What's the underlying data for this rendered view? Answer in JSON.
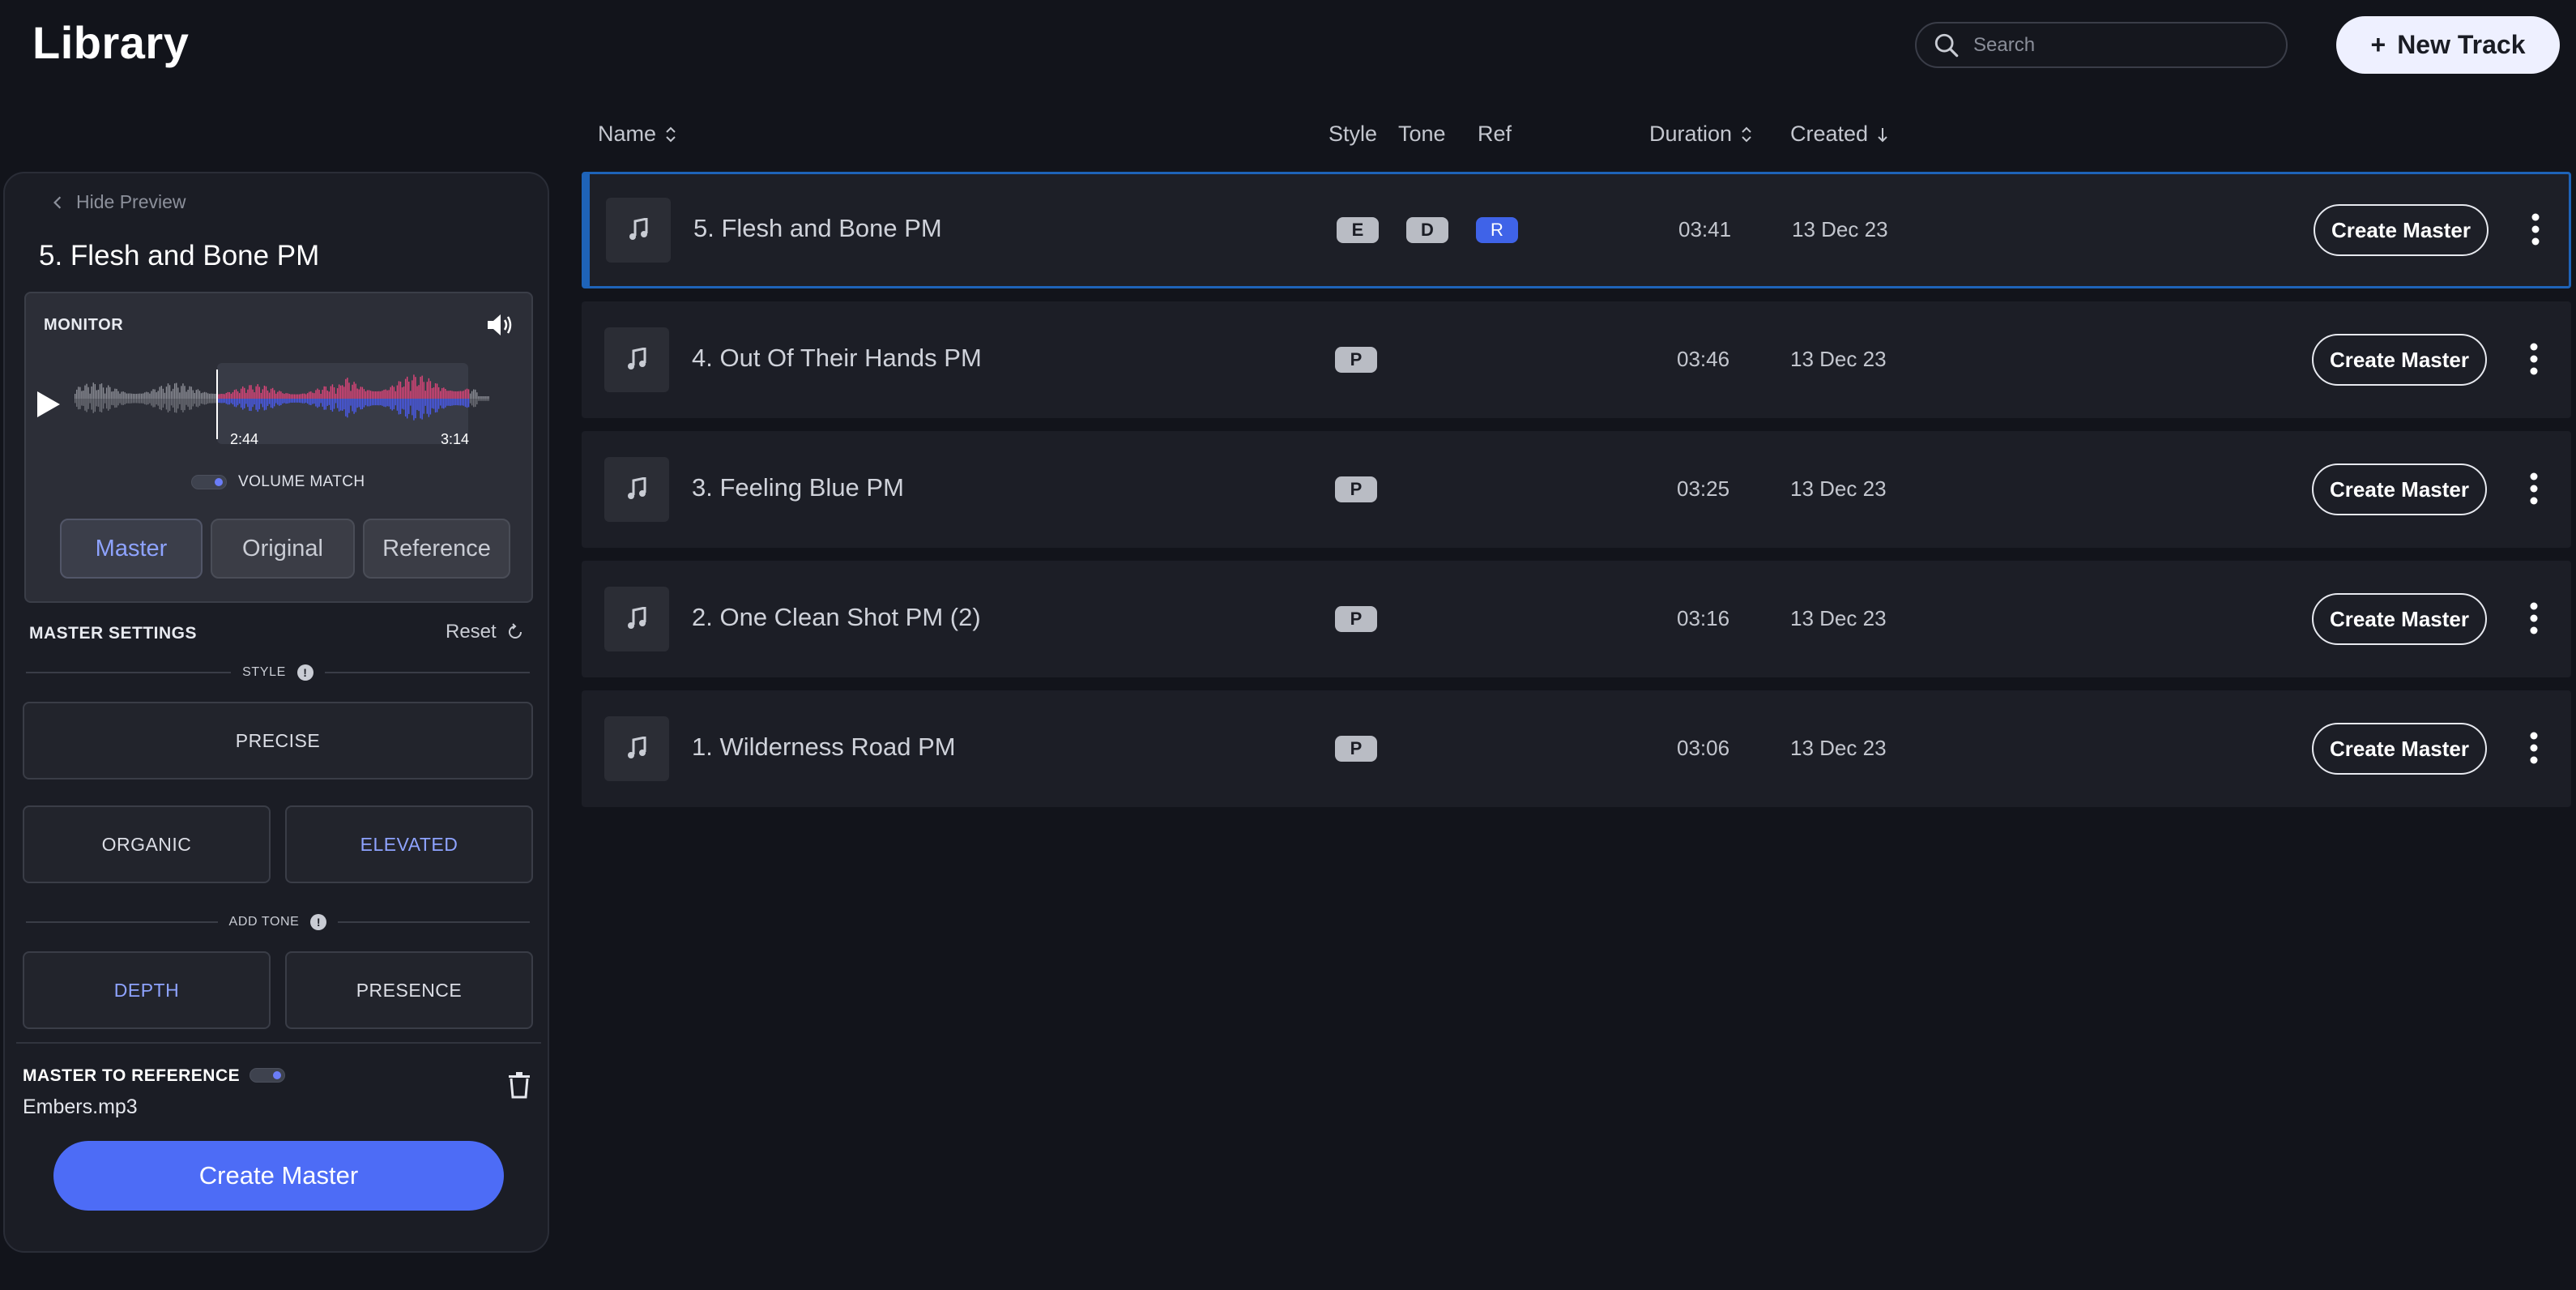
{
  "header": {
    "title": "Library",
    "search_placeholder": "Search",
    "new_track_label": "New Track"
  },
  "preview": {
    "hide_label": "Hide Preview",
    "track_title": "5. Flesh and Bone PM",
    "monitor": {
      "label": "MONITOR",
      "region_start": "2:44",
      "region_end": "3:14",
      "volume_match_label": "VOLUME MATCH",
      "modes": [
        "Master",
        "Original",
        "Reference"
      ],
      "active_mode": "Master"
    },
    "settings": {
      "title": "MASTER SETTINGS",
      "reset_label": "Reset",
      "style_label": "STYLE",
      "style_options": [
        "PRECISE",
        "ORGANIC",
        "ELEVATED"
      ],
      "active_style": "ELEVATED",
      "tone_label": "ADD TONE",
      "tone_options": [
        "DEPTH",
        "PRESENCE"
      ],
      "active_tone": "DEPTH"
    },
    "reference": {
      "title": "MASTER TO REFERENCE",
      "file": "Embers.mp3"
    },
    "create_label": "Create Master"
  },
  "table": {
    "columns": {
      "name": "Name",
      "style": "Style",
      "tone": "Tone",
      "ref": "Ref",
      "duration": "Duration",
      "created": "Created"
    },
    "row_button_label": "Create Master",
    "rows": [
      {
        "name": "5. Flesh and Bone PM",
        "style": "E",
        "tone": "D",
        "ref": "R",
        "duration": "03:41",
        "created": "13 Dec 23",
        "selected": true
      },
      {
        "name": "4. Out Of Their Hands PM",
        "style": "P",
        "tone": "",
        "ref": "",
        "duration": "03:46",
        "created": "13 Dec 23"
      },
      {
        "name": "3. Feeling Blue PM",
        "style": "P",
        "tone": "",
        "ref": "",
        "duration": "03:25",
        "created": "13 Dec 23"
      },
      {
        "name": "2. One Clean Shot PM (2)",
        "style": "P",
        "tone": "",
        "ref": "",
        "duration": "03:16",
        "created": "13 Dec 23"
      },
      {
        "name": "1. Wilderness Road PM",
        "style": "P",
        "tone": "",
        "ref": "",
        "duration": "03:06",
        "created": "13 Dec 23"
      }
    ]
  },
  "colors": {
    "background": "#12141b",
    "accent": "#4d6cf6",
    "active_text": "#8ea3ff",
    "selection_border": "#1e63b8"
  }
}
